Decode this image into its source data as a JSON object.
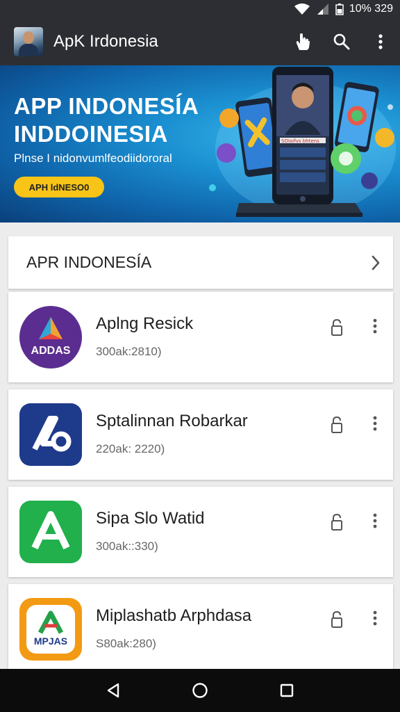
{
  "status": {
    "battery_text": "10% 329"
  },
  "appbar": {
    "title": "ApK Irdonesia",
    "icons": [
      "avatar",
      "hand-cursor-icon",
      "search-icon",
      "more-vert-icon"
    ]
  },
  "banner": {
    "headline_1": "APP INDONESÍA",
    "headline_2": "INDDOINESIA",
    "subtitle": "Plnse I nidonvumlfeodiidororal",
    "button_label": "APH ldNESO0",
    "phone_screen_text": "SOIaifvs bhtens"
  },
  "section": {
    "title": "APR INDONESÍA",
    "chevron_icon": "chevron-right-icon"
  },
  "apps": [
    {
      "name": "Aplng Resick",
      "meta": "300ak:2810)",
      "icon_text": "ADDAS",
      "icon_color": "#5b2d90"
    },
    {
      "name": "Sptalinnan Robarkar",
      "meta": "220ak: 2220)",
      "icon_text": "",
      "icon_color": "#1e3a8a"
    },
    {
      "name": "Sipa Slo Watid",
      "meta": "300ak::330)",
      "icon_text": "",
      "icon_color": "#21b04b"
    },
    {
      "name": "Miplashatb Arphdasa",
      "meta": "S80ak:280)",
      "icon_text": "MPJAS",
      "icon_color": "#f39a14"
    }
  ],
  "colors": {
    "bar": "#2c2e33",
    "banner": "#1a8ed0",
    "pill": "#f7c417"
  }
}
